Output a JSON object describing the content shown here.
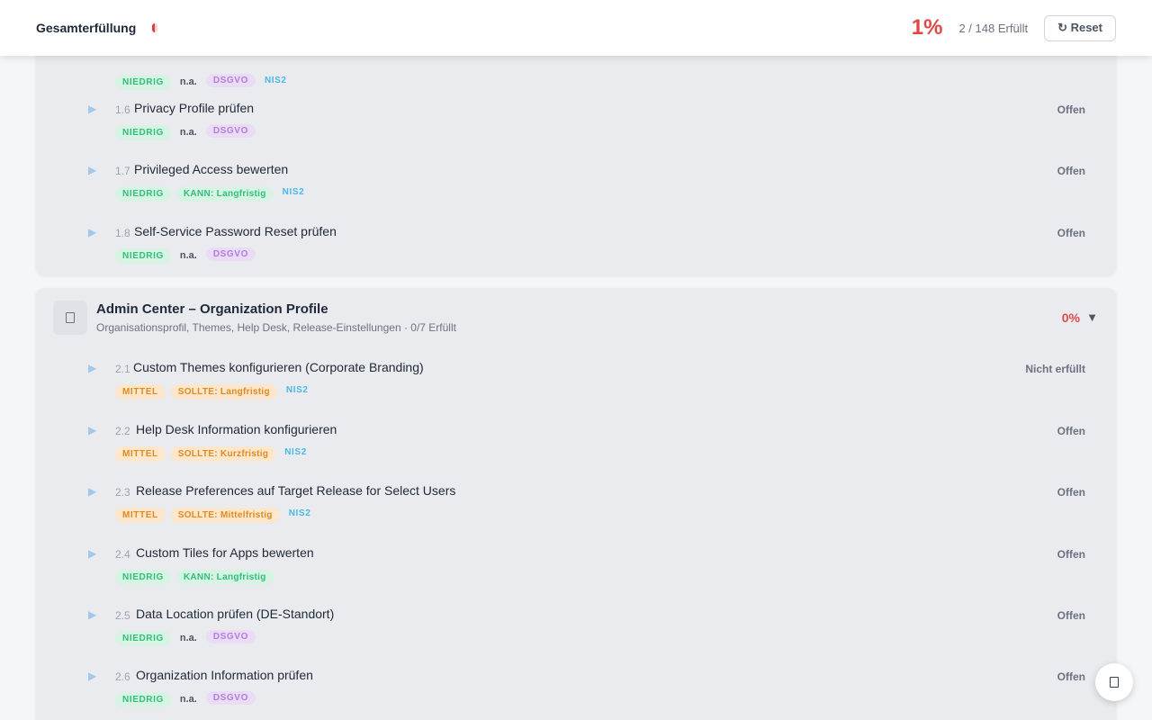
{
  "header": {
    "title": "Gesamterfüllung",
    "progress_fraction": 0.0135,
    "percent": "1%",
    "count": "2 / 148 Erfüllt",
    "reset_label": "↻ Reset"
  },
  "section1": {
    "items": [
      {
        "num": "",
        "title": "",
        "status": "",
        "badges": [
          {
            "type": "low",
            "text": "NIEDRIG"
          },
          {
            "type": "na",
            "text": "n.a."
          },
          {
            "type": "dsgvo",
            "text": "DSGVO"
          },
          {
            "type": "nis2",
            "text": "NIS2"
          }
        ]
      },
      {
        "num": "1.6",
        "title": "Privacy Profile prüfen",
        "status": "Offen",
        "badges": [
          {
            "type": "low",
            "text": "NIEDRIG"
          },
          {
            "type": "na",
            "text": "n.a."
          },
          {
            "type": "dsgvo",
            "text": "DSGVO"
          }
        ]
      },
      {
        "num": "1.7",
        "title": "Privileged Access bewerten",
        "status": "Offen",
        "badges": [
          {
            "type": "low",
            "text": "NIEDRIG"
          },
          {
            "type": "kann",
            "text": "KANN: Langfristig"
          },
          {
            "type": "nis2",
            "text": "NIS2"
          }
        ]
      },
      {
        "num": "1.8",
        "title": "Self-Service Password Reset prüfen",
        "status": "Offen",
        "badges": [
          {
            "type": "low",
            "text": "NIEDRIG"
          },
          {
            "type": "na",
            "text": "n.a."
          },
          {
            "type": "dsgvo",
            "text": "DSGVO"
          }
        ]
      }
    ]
  },
  "section2": {
    "title": "Admin Center – Organization Profile",
    "subtitle": "Organisationsprofil, Themes, Help Desk, Release-Einstellungen · 0/7 Erfüllt",
    "percent": "0%",
    "chevron": "▼",
    "items": [
      {
        "num": "2.1",
        "title": "Custom Themes konfigurieren (Corporate Branding)",
        "status": "Nicht erfüllt",
        "badges": [
          {
            "type": "med",
            "text": "MITTEL"
          },
          {
            "type": "sollte",
            "text": "SOLLTE: Langfristig"
          },
          {
            "type": "nis2",
            "text": "NIS2"
          }
        ]
      },
      {
        "num": "2.2",
        "title": "Help Desk Information konfigurieren",
        "status": "Offen",
        "badges": [
          {
            "type": "med",
            "text": "MITTEL"
          },
          {
            "type": "sollte",
            "text": "SOLLTE: Kurzfristig"
          },
          {
            "type": "nis2",
            "text": "NIS2"
          }
        ]
      },
      {
        "num": "2.3",
        "title": "Release Preferences auf Target Release for Select Users",
        "status": "Offen",
        "badges": [
          {
            "type": "med",
            "text": "MITTEL"
          },
          {
            "type": "sollte",
            "text": "SOLLTE: Mittelfristig"
          },
          {
            "type": "nis2",
            "text": "NIS2"
          }
        ]
      },
      {
        "num": "2.4",
        "title": "Custom Tiles for Apps bewerten",
        "status": "Offen",
        "badges": [
          {
            "type": "low",
            "text": "NIEDRIG"
          },
          {
            "type": "kann",
            "text": "KANN: Langfristig"
          }
        ]
      },
      {
        "num": "2.5",
        "title": "Data Location prüfen (DE-Standort)",
        "status": "Offen",
        "badges": [
          {
            "type": "low",
            "text": "NIEDRIG"
          },
          {
            "type": "na",
            "text": "n.a."
          },
          {
            "type": "dsgvo",
            "text": "DSGVO"
          }
        ]
      },
      {
        "num": "2.6",
        "title": "Organization Information prüfen",
        "status": "Offen",
        "badges": [
          {
            "type": "low",
            "text": "NIEDRIG"
          },
          {
            "type": "na",
            "text": "n.a."
          },
          {
            "type": "dsgvo",
            "text": "DSGVO"
          }
        ]
      }
    ]
  },
  "icons": {
    "item_toggle": "play-triangle-icon",
    "section_icon": "document-icon",
    "fab_icon": "document-icon"
  }
}
